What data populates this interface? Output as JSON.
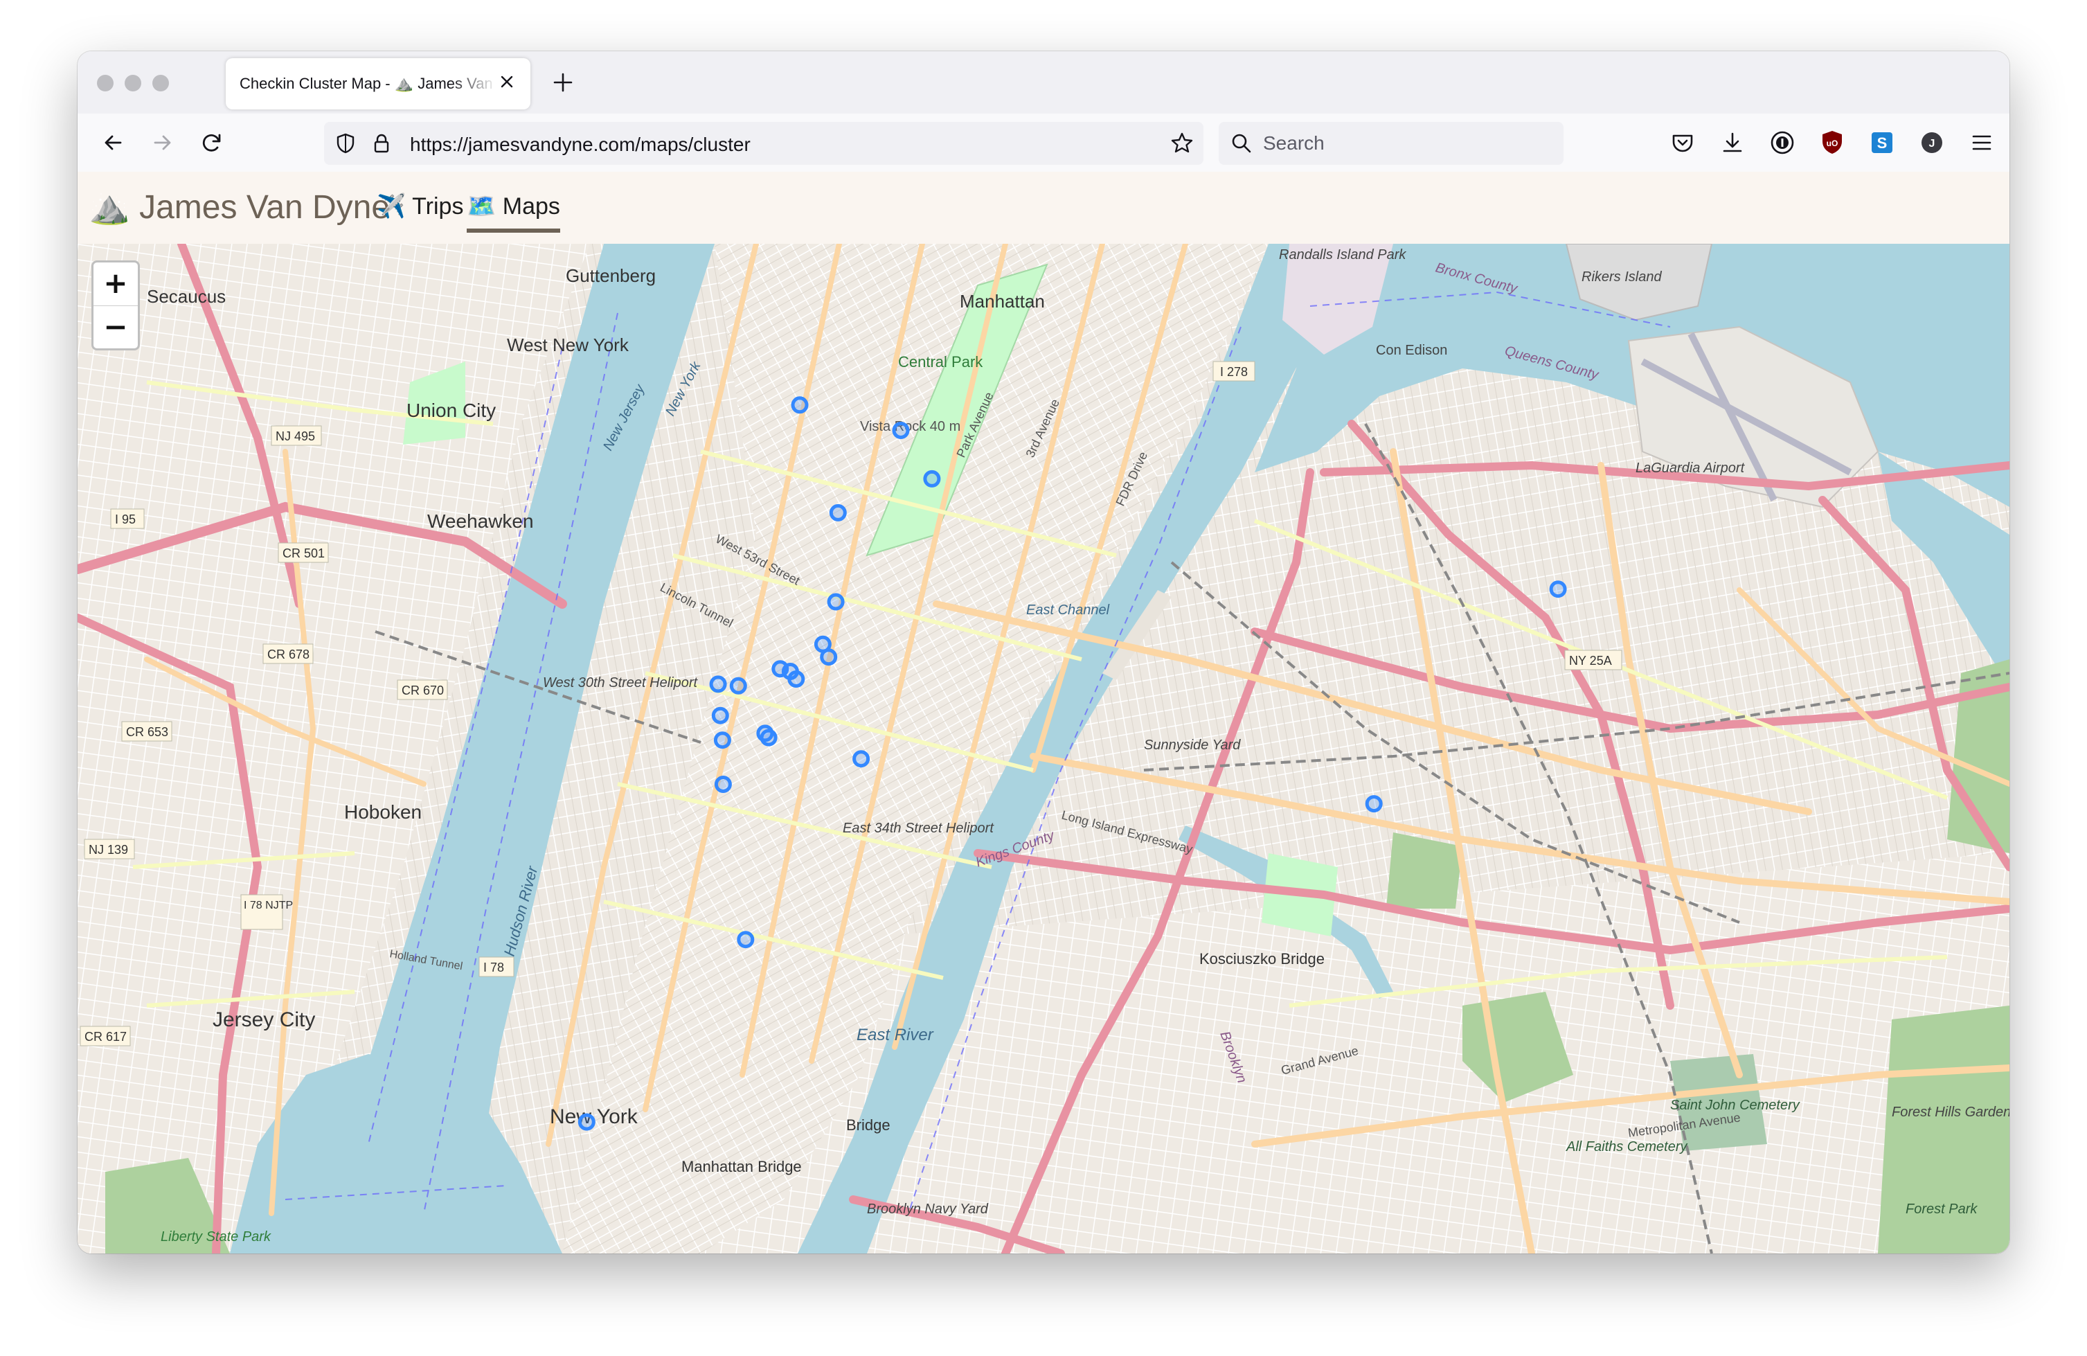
{
  "browser": {
    "tab_title": "Checkin Cluster Map - ⛰️ James Van Dyne",
    "new_tab_label": "+",
    "url": "https://jamesvandyne.com/maps/cluster",
    "search_placeholder": "Search",
    "profile_initial": "J"
  },
  "site": {
    "title": "⛰️ James Van Dyne",
    "nav": [
      {
        "label": "✈️ Trips"
      },
      {
        "label": "🗺️ Maps"
      }
    ]
  },
  "map": {
    "zoom_in": "+",
    "zoom_out": "−",
    "labels": {
      "secaucus": "Secaucus",
      "guttenberg": "Guttenberg",
      "west_new_york": "West New York",
      "union_city": "Union City",
      "weehawken": "Weehawken",
      "hoboken": "Hoboken",
      "jersey_city": "Jersey City",
      "manhattan": "Manhattan",
      "central_park": "Central Park",
      "vista_rock": "Vista Rock 40 m",
      "new_york": "New York",
      "rikers_island": "Rikers Island",
      "randalls_island": "Randalls Island Park",
      "con_edison": "Con Edison",
      "laguardia": "LaGuardia Airport",
      "kosciuszko_bridge": "Kosciuszko Bridge",
      "sunnyside_yard": "Sunnyside Yard",
      "east_34th_heliport": "East 34th Street Heliport",
      "west_30th_heliport": "West 30th Street Heliport",
      "east_channel": "East Channel",
      "east_river": "East River",
      "brooklyn_navy_yard": "Brooklyn Navy Yard",
      "manhattan_bridge": "Manhattan Bridge",
      "bridge": "Bridge",
      "liberty_state_park": "Liberty State Park",
      "saint_john_cemetery": "Saint John Cemetery",
      "all_faiths_cemetery": "All Faiths Cemetery",
      "forest_hills_gardens": "Forest Hills Gardens",
      "forest_park": "Forest Park",
      "long_island_expressway": "Long Island Expressway",
      "grand_avenue": "Grand Avenue",
      "metropolitan_avenue": "Metropolitan Avenue",
      "i_278": "I 278",
      "i_95": "I 95",
      "i_78_njtp": "I 78 NJTP",
      "i_78": "I 78",
      "nj_495": "NJ 495",
      "nj_139": "NJ 139",
      "ny_25a": "NY 25A",
      "cr_501": "CR 501",
      "cr_678": "CR 678",
      "cr_670": "CR 670",
      "cr_653": "CR 653",
      "cr_617": "CR 617",
      "holland_tunnel": "Holland Tunnel",
      "lincoln_tunnel": "Lincoln Tunnel",
      "west_53rd": "West 53rd Street",
      "park_avenue": "Park Avenue",
      "third_avenue": "3rd Avenue",
      "fdr_drive": "FDR Drive",
      "new_jersey": "New Jersey",
      "new_york_water": "New York",
      "queens_county": "Queens County",
      "bronx_county": "Bronx County",
      "kings_county": "Kings County",
      "brooklyn": "Brooklyn",
      "hudson_river": "Hudson River"
    },
    "checkins": [
      {
        "lat": 40.7935,
        "lon": -73.9705
      },
      {
        "lat": 40.7905,
        "lon": -73.9565
      },
      {
        "lat": 40.7848,
        "lon": -73.9522
      },
      {
        "lat": 40.7808,
        "lon": -73.9652
      },
      {
        "lat": 40.7703,
        "lon": -73.9655
      },
      {
        "lat": 40.7653,
        "lon": -73.9673
      },
      {
        "lat": 40.7638,
        "lon": -73.9665
      },
      {
        "lat": 40.7624,
        "lon": -73.9732
      },
      {
        "lat": 40.7621,
        "lon": -73.9718
      },
      {
        "lat": 40.7612,
        "lon": -73.971
      },
      {
        "lat": 40.7606,
        "lon": -73.9818
      },
      {
        "lat": 40.7604,
        "lon": -73.979
      },
      {
        "lat": 40.7569,
        "lon": -73.9815
      },
      {
        "lat": 40.7548,
        "lon": -73.9753
      },
      {
        "lat": 40.7543,
        "lon": -73.9748
      },
      {
        "lat": 40.754,
        "lon": -73.9812
      },
      {
        "lat": 40.7518,
        "lon": -73.962
      },
      {
        "lat": 40.7488,
        "lon": -73.9811
      },
      {
        "lat": 40.7305,
        "lon": -73.978
      },
      {
        "lat": 40.709,
        "lon": -74.0
      },
      {
        "lat": 40.7718,
        "lon": -73.8655
      },
      {
        "lat": 40.7465,
        "lon": -73.891
      }
    ]
  }
}
